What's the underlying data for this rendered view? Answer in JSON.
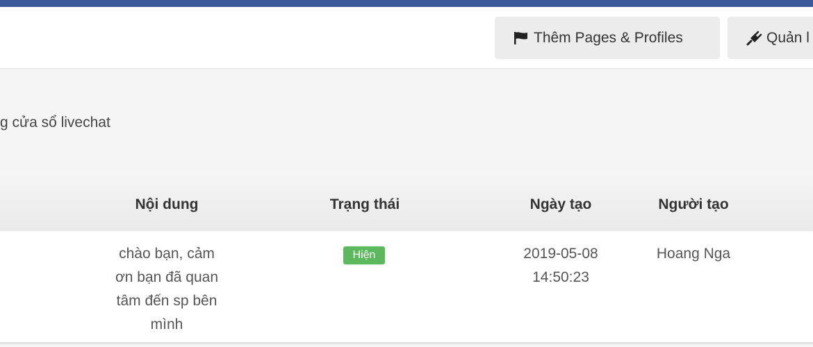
{
  "header": {
    "add_pages_button": "Thêm Pages & Profiles",
    "manage_button": "Quản l",
    "icons": [
      "flag-icon",
      "plug-icon"
    ]
  },
  "content": {
    "description": "g cửa sổ livechat"
  },
  "table": {
    "columns": [
      "Nội dung",
      "Trạng thái",
      "Ngày tạo",
      "Người tạo"
    ],
    "rows": [
      {
        "content_lines": [
          "chào bạn, cảm",
          "ơn bạn đã quan",
          "tâm đến sp bên",
          "mình"
        ],
        "status": "Hiện",
        "date_lines": [
          "2019-05-08",
          "14:50:23"
        ],
        "creator": "Hoang Nga"
      }
    ]
  },
  "colors": {
    "top_bar": "#3b5998",
    "status_badge": "#5cb85c",
    "button_bg": "#ececec",
    "panel_bg": "#f5f5f5"
  }
}
